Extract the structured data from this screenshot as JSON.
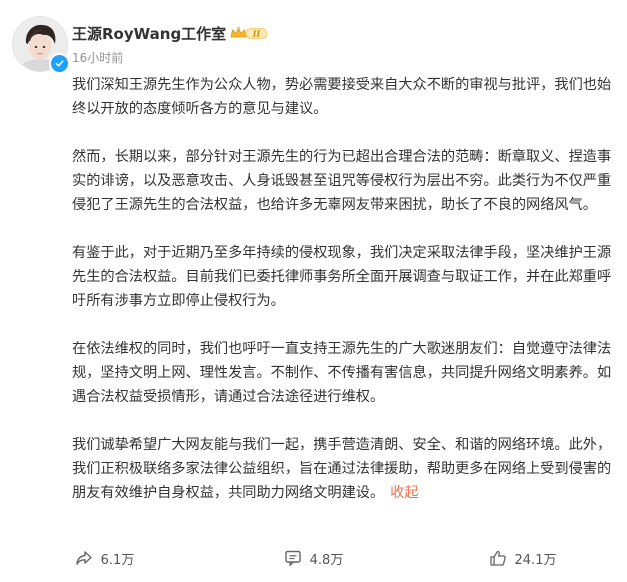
{
  "author": {
    "name": "王源RoyWang工作室",
    "timestamp": "16小时前",
    "verified_color": "#1aa1ff",
    "vip_badge_color": "#f5b82e"
  },
  "post": {
    "paragraphs": [
      "我们深知王源先生作为公众人物，势必需要接受来自大众不断的审视与批评，我们也始终以开放的态度倾听各方的意见与建议。",
      "然而，长期以来，部分针对王源先生的行为已超出合理合法的范畴：断章取义、捏造事实的诽谤，以及恶意攻击、人身诋毁甚至诅咒等侵权行为层出不穷。此类行为不仅严重侵犯了王源先生的合法权益，也给许多无辜网友带来困扰，助长了不良的网络风气。",
      "有鉴于此，对于近期乃至多年持续的侵权现象，我们决定采取法律手段，坚决维护王源先生的合法权益。目前我们已委托律师事务所全面开展调查与取证工作，并在此郑重呼吁所有涉事方立即停止侵权行为。",
      "在依法维权的同时，我们也呼吁一直支持王源先生的广大歌迷朋友们：自觉遵守法律法规，坚持文明上网、理性发言。不制作、不传播有害信息，共同提升网络文明素养。如遇合法权益受损情形，请通过合法途径进行维权。",
      "我们诚挚希望广大网友能与我们一起，携手营造清朗、安全、和谐的网络环境。此外，我们正积极联络多家法律公益组织，旨在通过法律援助，帮助更多在网络上受到侵害的朋友有效维护自身权益，共同助力网络文明建设。"
    ],
    "collapse_label": "收起",
    "link_color": "#eb7350"
  },
  "actions": {
    "share": {
      "icon": "share-icon",
      "count": "6.1万"
    },
    "comment": {
      "icon": "comment-icon",
      "count": "4.8万"
    },
    "like": {
      "icon": "thumbs-up-icon",
      "count": "24.1万"
    }
  }
}
